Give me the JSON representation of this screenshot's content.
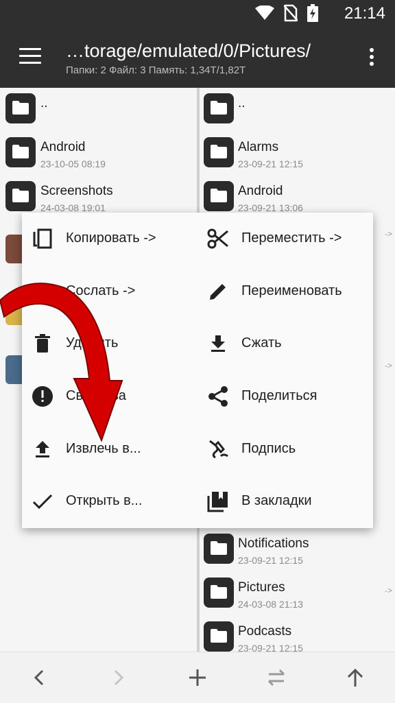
{
  "status_bar": {
    "time": "21:14",
    "icons": [
      "wifi-icon",
      "no-sim-icon",
      "battery-charging-icon"
    ]
  },
  "app_bar": {
    "title": "…torage/emulated/0/Pictures/",
    "subtitle": "Папки: 2  Файл: 3  Память: 1,34T/1,82T",
    "menu_icon": "hamburger-icon",
    "more_icon": "more-vertical-icon"
  },
  "left_pane": {
    "items": [
      {
        "name": "..",
        "date": ""
      },
      {
        "name": "Android",
        "date": "23-10-05 08:19"
      },
      {
        "name": "Screenshots",
        "date": "24-03-08 19:01"
      }
    ]
  },
  "right_pane": {
    "items_top": [
      {
        "name": "..",
        "date": ""
      },
      {
        "name": "Alarms",
        "date": "23-09-21 12:15"
      },
      {
        "name": "Android",
        "date": "23-09-21 13:06"
      }
    ],
    "items_bottom": [
      {
        "name": "Notifications",
        "date": "23-09-21 12:15",
        "tag": ""
      },
      {
        "name": "Pictures",
        "date": "24-03-08 21:13",
        "tag": "->"
      },
      {
        "name": "Podcasts",
        "date": "23-09-21 12:15",
        "tag": ""
      }
    ],
    "side_tags": [
      "->",
      "->"
    ]
  },
  "context_menu": {
    "left": [
      {
        "label": "Копировать ->",
        "icon": "copy-icon"
      },
      {
        "label": "Сослать ->",
        "icon": "link-icon"
      },
      {
        "label": "Удалить",
        "icon": "trash-icon"
      },
      {
        "label": "Свойства",
        "icon": "info-icon"
      },
      {
        "label": "Извлечь в...",
        "icon": "upload-icon"
      },
      {
        "label": "Открыть в...",
        "icon": "check-icon"
      }
    ],
    "right": [
      {
        "label": "Переместить ->",
        "icon": "scissors-icon"
      },
      {
        "label": "Переименовать",
        "icon": "pencil-icon"
      },
      {
        "label": "Сжать",
        "icon": "download-icon"
      },
      {
        "label": "Поделиться",
        "icon": "share-icon"
      },
      {
        "label": "Подпись",
        "icon": "signature-icon"
      },
      {
        "label": "В закладки",
        "icon": "bookmarks-icon"
      }
    ]
  },
  "bottom_bar": {
    "buttons": [
      "back-icon",
      "forward-icon",
      "add-icon",
      "swap-icon",
      "up-icon"
    ]
  },
  "colors": {
    "bar": "#2f2f2f",
    "menu_bg": "#fafafa",
    "annotation_arrow": "#d40000"
  }
}
